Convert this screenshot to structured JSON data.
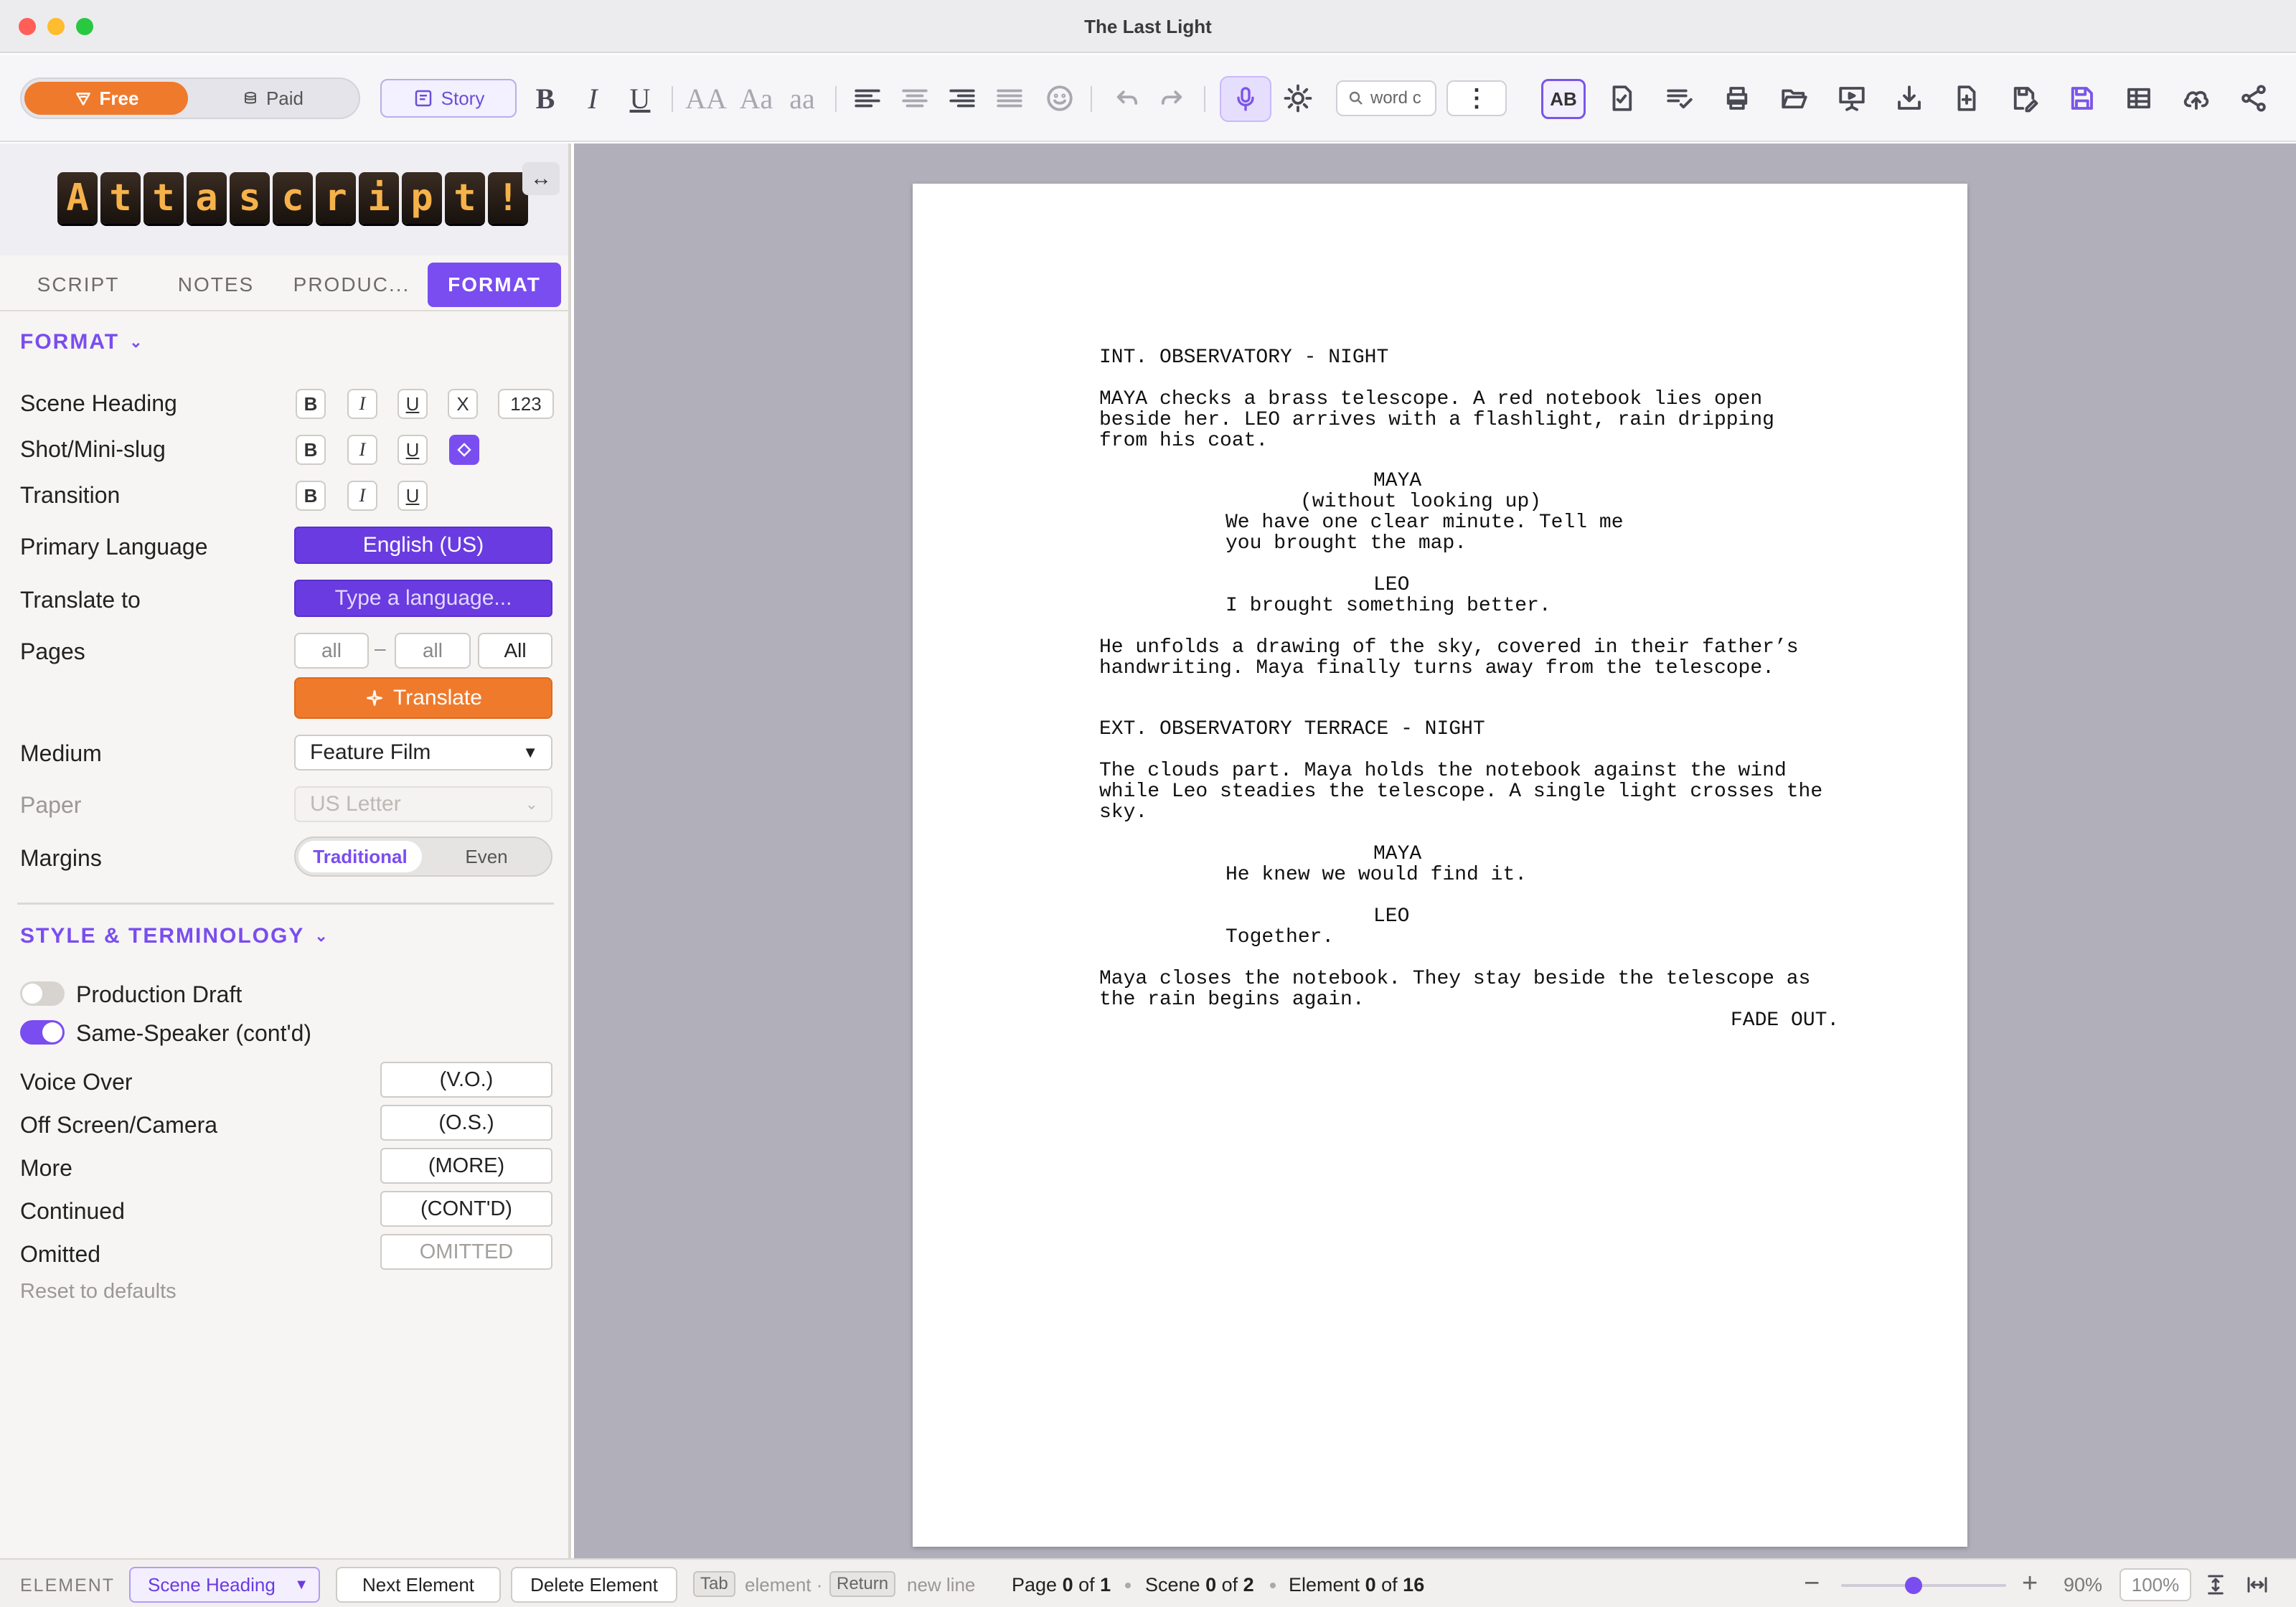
{
  "window": {
    "title": "The Last Light"
  },
  "toolbar": {
    "free_label": "Free",
    "paid_label": "Paid",
    "story_label": "Story",
    "bold": "B",
    "italic": "I",
    "underline": "U",
    "case_upper": "AA",
    "case_title": "Aa",
    "case_lower": "aa",
    "search_placeholder": "word c",
    "more": "⋮",
    "spell_label": "AB"
  },
  "sidebar": {
    "logo_text": "Attascript!",
    "expand": "↔",
    "tabs": [
      "SCRIPT",
      "NOTES",
      "PRODUC...",
      "FORMAT"
    ],
    "format": {
      "heading": "FORMAT",
      "rows": {
        "scene_heading": "Scene Heading",
        "shot": "Shot/Mini-slug",
        "transition": "Transition",
        "primary_language": "Primary Language",
        "translate_to": "Translate to",
        "pages": "Pages",
        "medium": "Medium",
        "paper": "Paper",
        "margins": "Margins"
      },
      "bold": "B",
      "italic": "I",
      "underline": "U",
      "clear": "X",
      "numbering": "123",
      "primary_language_value": "English (US)",
      "translate_placeholder": "Type a language...",
      "pages_from": "all",
      "pages_dash": "–",
      "pages_to": "all",
      "pages_all": "All",
      "translate_button": "Translate",
      "medium_value": "Feature Film",
      "paper_value": "US Letter",
      "margin_options": [
        "Traditional",
        "Even"
      ]
    },
    "style": {
      "heading": "STYLE & TERMINOLOGY",
      "production_draft": "Production Draft",
      "production_draft_on": false,
      "same_speaker": "Same-Speaker (cont'd)",
      "same_speaker_on": true,
      "terms": [
        {
          "label": "Voice Over",
          "value": "(V.O.)"
        },
        {
          "label": "Off Screen/Camera",
          "value": "(O.S.)"
        },
        {
          "label": "More",
          "value": "(MORE)"
        },
        {
          "label": "Continued",
          "value": "(CONT'D)"
        },
        {
          "label": "Omitted",
          "value": "OMITTED"
        }
      ],
      "reset": "Reset to defaults"
    }
  },
  "script": {
    "scene1_heading": "INT. OBSERVATORY - NIGHT",
    "action1": "MAYA checks a brass telescope. A red notebook lies open\nbeside her. LEO arrives with a flashlight, rain dripping\nfrom his coat.",
    "char1": "MAYA",
    "paren1": "(without looking up)",
    "dialogue1": "We have one clear minute. Tell me\nyou brought the map.",
    "char2": "LEO",
    "dialogue2": "I brought something better.",
    "action2": "He unfolds a drawing of the sky, covered in their father’s\nhandwriting. Maya finally turns away from the telescope.",
    "scene2_heading": "EXT. OBSERVATORY TERRACE - NIGHT",
    "action3": "The clouds part. Maya holds the notebook against the wind\nwhile Leo steadies the telescope. A single light crosses the\nsky.",
    "char3": "MAYA",
    "dialogue3": "He knew we would find it.",
    "char4": "LEO",
    "dialogue4": "Together.",
    "action4": "Maya closes the notebook. They stay beside the telescope as\nthe rain begins again.",
    "transition": "FADE OUT."
  },
  "statusbar": {
    "element_label": "ELEMENT",
    "element_value": "Scene Heading",
    "next_element": "Next Element",
    "delete_element": "Delete Element",
    "tab_key": "Tab",
    "tab_hint": "element ·",
    "return_key": "Return",
    "return_hint": "new line",
    "page_text": "Page",
    "page_current": "0",
    "page_of": "of",
    "page_total": "1",
    "scene_text": "Scene",
    "scene_current": "0",
    "scene_of": "of",
    "scene_total": "2",
    "element_text": "Element",
    "element_current": "0",
    "element_of": "of",
    "element_total": "16",
    "zoom_out": "−",
    "zoom_in": "+",
    "zoom_level": 0.44,
    "zoom_percent": "90%",
    "zoom_reset": "100%"
  }
}
